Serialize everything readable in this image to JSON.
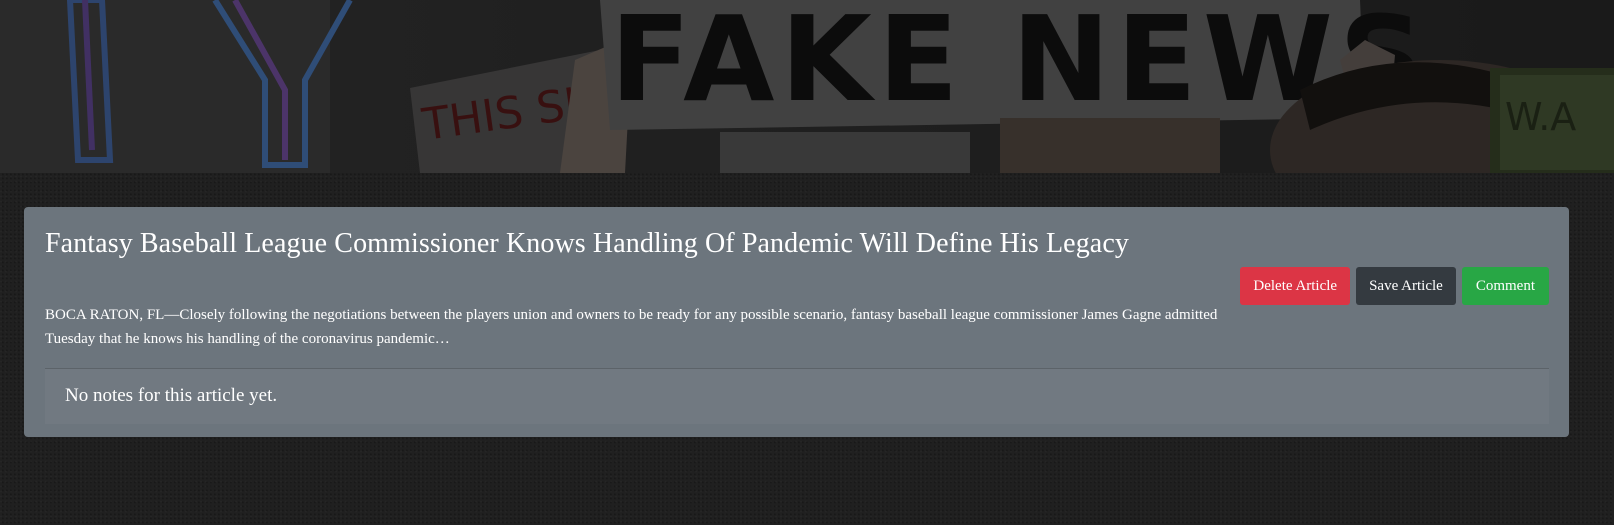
{
  "hero": {
    "sign_text": "FAKE NEWS",
    "left_sign_text": "THIS SHA"
  },
  "article": {
    "title": "Fantasy Baseball League Commissioner Knows Handling Of Pandemic Will Define His Legacy",
    "summary": "BOCA RATON, FL—Closely following the negotiations between the players union and owners to be ready for any possible scenario, fantasy baseball league commissioner James Gagne admitted Tuesday that he knows his handling of the coronavirus pandemic…",
    "actions": {
      "delete_label": "Delete Article",
      "save_label": "Save Article",
      "comment_label": "Comment"
    },
    "notes_text": "No notes for this article yet."
  },
  "colors": {
    "card_bg": "#6c757d",
    "danger": "#dc3545",
    "dark": "#343a40",
    "success": "#28a745"
  }
}
